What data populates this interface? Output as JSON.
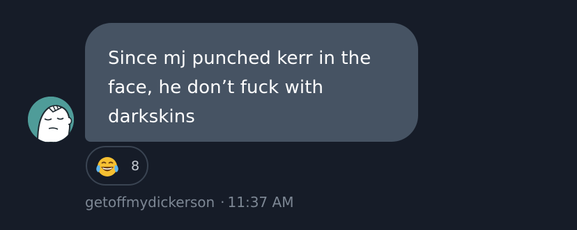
{
  "message": {
    "text": "Since mj punched kerr in the face, he don’t fuck with darkskins",
    "sender": "getoffmydickerson",
    "separator": "·",
    "time": "11:37 AM"
  },
  "reaction": {
    "emoji": "face-with-tears-of-joy-icon",
    "count": "8"
  },
  "colors": {
    "background": "#161c28",
    "bubble": "#465363",
    "avatar": "#4f9c99",
    "meta_text": "#7d8794"
  }
}
